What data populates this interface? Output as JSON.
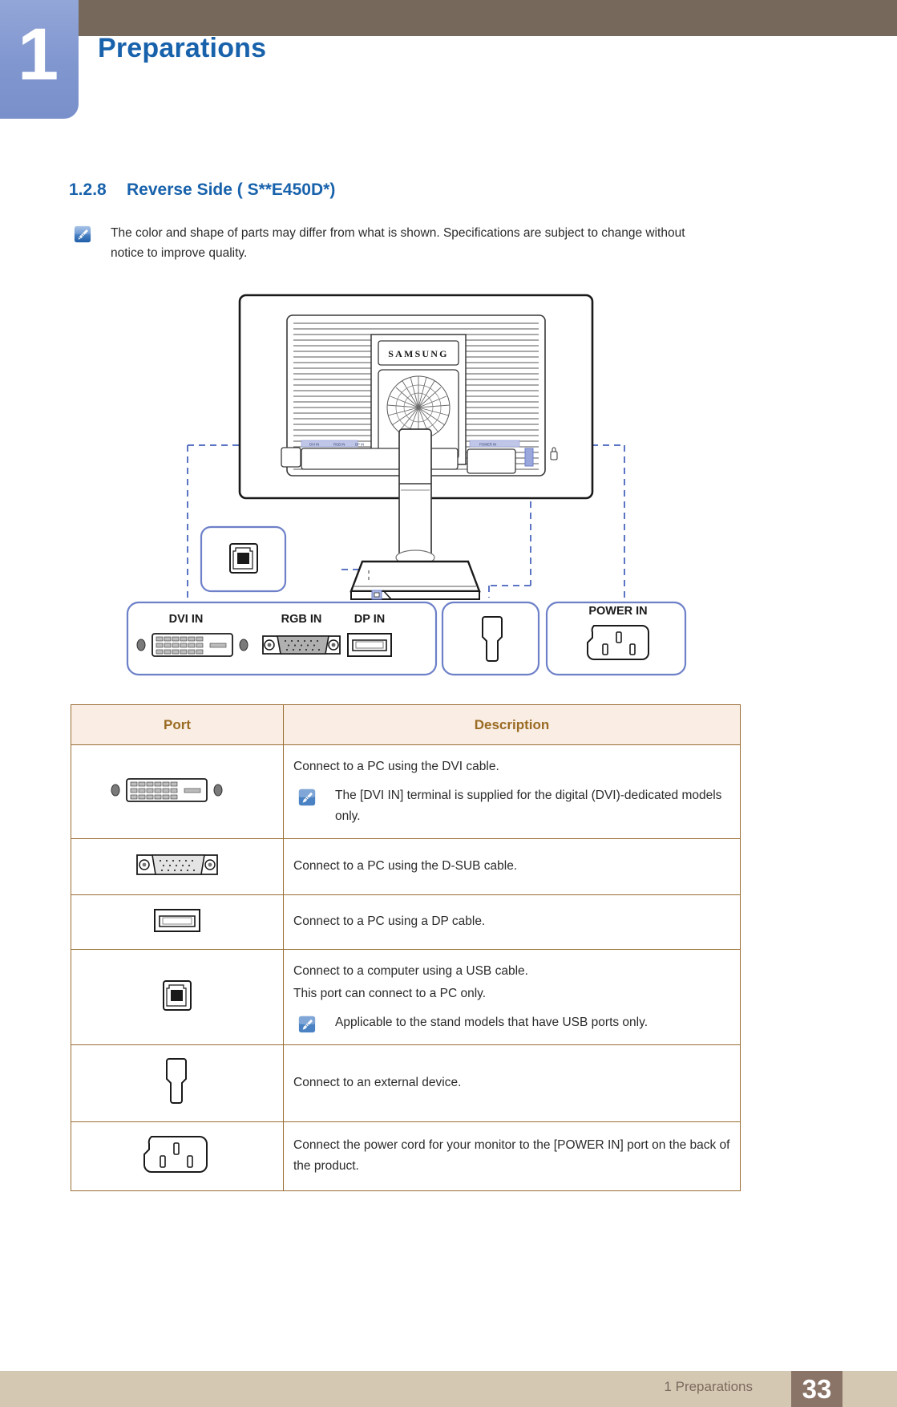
{
  "header": {
    "chapter_number": "1",
    "title": "Preparations",
    "band_color": "#76685a",
    "tab_color": "#8096cf",
    "title_color": "#1862ac"
  },
  "section": {
    "number": "1.2.8",
    "title": "Reverse Side ( S**E450D*)"
  },
  "intro_note": {
    "icon": "note-pen-icon",
    "text": "The color and shape of parts may differ from what is shown. Specifications are subject to change without notice to improve quality."
  },
  "diagram": {
    "brand_label": "SAMSUNG",
    "callouts": [
      {
        "label": "DVI IN",
        "icon": "dvi-port-icon"
      },
      {
        "label": "RGB IN",
        "icon": "vga-port-icon"
      },
      {
        "label": "DP IN",
        "icon": "displayport-port-icon"
      },
      {
        "label": "",
        "icon": "usb-b-port-icon"
      },
      {
        "label": "",
        "icon": "audio-jack-port-icon"
      },
      {
        "label": "POWER IN",
        "icon": "power-inlet-icon"
      }
    ],
    "accent_color": "#6d80c8"
  },
  "table": {
    "headers": {
      "port": "Port",
      "description": "Description"
    },
    "header_bg": "#f9ede4",
    "header_text_color": "#9a6b22",
    "border_color": "#9a6d33",
    "rows": [
      {
        "icon": "dvi-port-icon",
        "lines": [
          "Connect to a PC using the DVI cable."
        ],
        "note": {
          "icon": "note-pen-icon",
          "text": "The [DVI IN] terminal is supplied for the digital (DVI)-dedicated models only."
        }
      },
      {
        "icon": "vga-port-icon",
        "lines": [
          "Connect to a PC using the D-SUB cable."
        ],
        "note": null
      },
      {
        "icon": "displayport-port-icon",
        "lines": [
          "Connect to a PC using a DP cable."
        ],
        "note": null
      },
      {
        "icon": "usb-b-port-icon",
        "lines": [
          "Connect to a computer using a USB cable.",
          "This port can connect to a PC only."
        ],
        "note": {
          "icon": "note-pen-icon",
          "text": "Applicable to the stand models that have USB ports only."
        }
      },
      {
        "icon": "audio-jack-port-icon",
        "lines": [
          "Connect to an external device."
        ],
        "note": null
      },
      {
        "icon": "power-inlet-icon",
        "lines": [
          "Connect the power cord for your monitor to the [POWER IN] port on the back of the product."
        ],
        "note": null
      }
    ]
  },
  "footer": {
    "label": "1 Preparations",
    "page_number": "33",
    "band_color": "#d5c8b3",
    "page_box_color": "#8a7467"
  }
}
